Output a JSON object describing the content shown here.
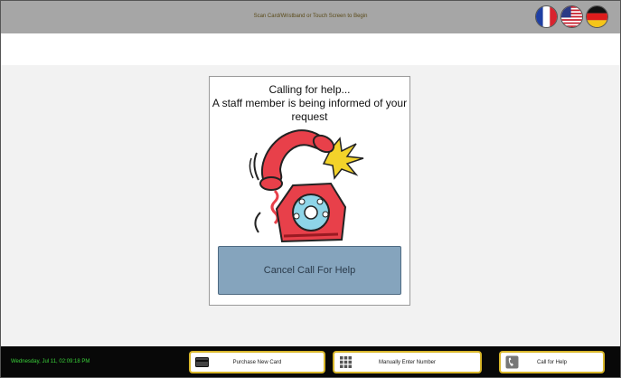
{
  "header": {
    "message": "Scan Card/Wristband or Touch Screen to Begin",
    "languages": [
      {
        "name": "french-flag-icon"
      },
      {
        "name": "us-flag-icon"
      },
      {
        "name": "german-flag-icon"
      }
    ]
  },
  "dialog": {
    "line1": "Calling for help...",
    "line2": "A staff member is being informed of your request",
    "image": "ringing-phone-icon",
    "cancel_label": "Cancel Call For Help"
  },
  "footer": {
    "datetime": "Wednesday, Jul 11, 02:09:18 PM",
    "buttons": {
      "purchase": {
        "label": "Purchase New Card",
        "icon": "card-icon"
      },
      "manual": {
        "label": "Manually Enter Number",
        "icon": "keypad-icon"
      },
      "help": {
        "label": "Call for Help",
        "icon": "phone-icon"
      }
    }
  },
  "colors": {
    "header_bg": "#a6a6a6",
    "footer_bg": "#080808",
    "button_border": "#d8b62a",
    "cancel_bg": "#85a4bd",
    "datetime_text": "#3ad23a"
  }
}
